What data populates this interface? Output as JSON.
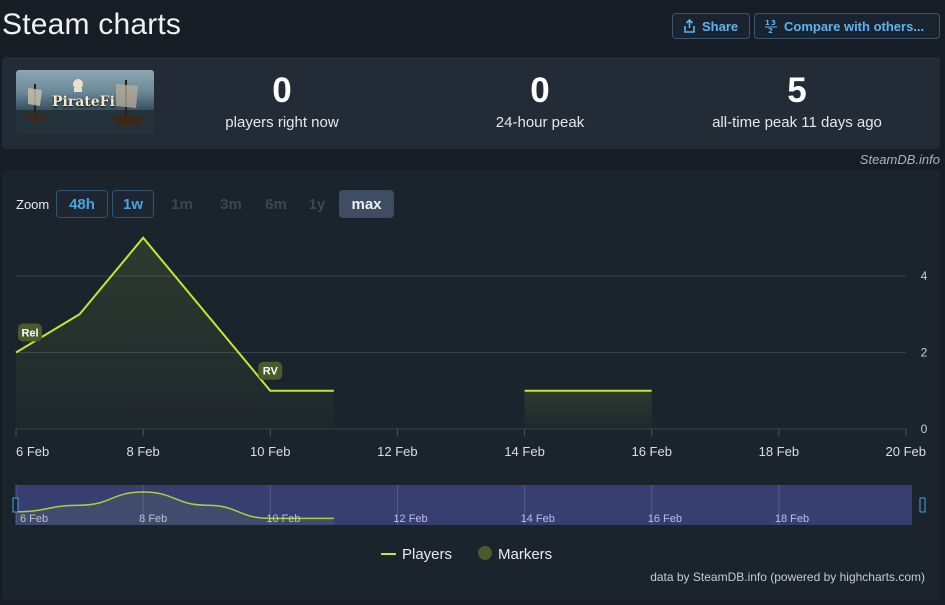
{
  "header": {
    "title": "Steam charts",
    "share_label": "Share",
    "compare_label": "Compare with others..."
  },
  "game": {
    "name": "PirateFi"
  },
  "stats": [
    {
      "value": "0",
      "label": "players right now"
    },
    {
      "value": "0",
      "label": "24-hour peak"
    },
    {
      "value": "5",
      "label": "all-time peak 11 days ago"
    }
  ],
  "stats_credit": "SteamDB.info",
  "zoom": {
    "label": "Zoom",
    "options": [
      {
        "label": "48h",
        "state": "enabled"
      },
      {
        "label": "1w",
        "state": "enabled"
      },
      {
        "label": "1m",
        "state": "disabled"
      },
      {
        "label": "3m",
        "state": "disabled"
      },
      {
        "label": "6m",
        "state": "disabled"
      },
      {
        "label": "1y",
        "state": "disabled"
      },
      {
        "label": "max",
        "state": "selected"
      }
    ]
  },
  "chart_data": {
    "type": "line",
    "title": "",
    "xlabel": "",
    "ylabel": "",
    "xlim": [
      "6 Feb",
      "20 Feb"
    ],
    "x_ticks": [
      "6 Feb",
      "8 Feb",
      "10 Feb",
      "12 Feb",
      "14 Feb",
      "16 Feb",
      "18 Feb",
      "20 Feb"
    ],
    "ylim": [
      0,
      5
    ],
    "y_ticks": [
      0,
      2,
      4
    ],
    "grid": true,
    "series": [
      {
        "name": "Players",
        "color": "#c2e833",
        "segments": [
          [
            {
              "x": "6 Feb",
              "y": 2
            },
            {
              "x": "7 Feb",
              "y": 3
            },
            {
              "x": "8 Feb",
              "y": 5
            },
            {
              "x": "9 Feb",
              "y": 3
            },
            {
              "x": "10 Feb",
              "y": 1
            },
            {
              "x": "11 Feb",
              "y": 1
            }
          ],
          [
            {
              "x": "14 Feb",
              "y": 1
            },
            {
              "x": "15 Feb",
              "y": 1
            },
            {
              "x": "16 Feb",
              "y": 1
            }
          ]
        ]
      }
    ],
    "markers": [
      {
        "label": "Rel",
        "x": "6 Feb"
      },
      {
        "label": "RV",
        "x": "10 Feb"
      }
    ],
    "markers_series_name": "Markers",
    "markers_color": "#4a5a2a",
    "navigator": {
      "x_ticks": [
        "6 Feb",
        "8 Feb",
        "10 Feb",
        "12 Feb",
        "14 Feb",
        "16 Feb",
        "18 Feb"
      ]
    },
    "legend_position": "bottom"
  },
  "footer_credit": "data by SteamDB.info (powered by highcharts.com)"
}
